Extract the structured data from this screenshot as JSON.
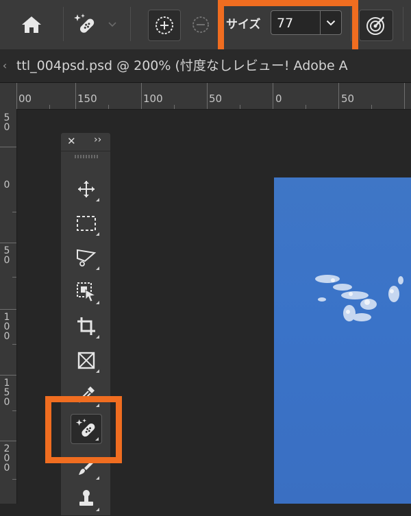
{
  "options_bar": {
    "home_icon": "home-icon",
    "tool_icon": "spot-healing-brush-icon",
    "add_icon": "circle-plus-icon",
    "subtract_icon": "circle-minus-icon",
    "size_label": "サイズ",
    "size_value": "77",
    "target_icon": "target-brush-icon"
  },
  "tab": {
    "title": "ttl_004psd.psd @ 200% (忖度なしレビュー! Adobe A",
    "scroll_left": "‹"
  },
  "ruler_h": {
    "labels": [
      "00",
      "150",
      "100",
      "50",
      "0",
      "50"
    ]
  },
  "ruler_v": {
    "labels": [
      "5\n0",
      "0",
      "5\n0",
      "1\n0\n0",
      "1\n5\n0",
      "2\n0\n0"
    ]
  },
  "tools_panel": {
    "close": "✕",
    "expand": "››",
    "tools": [
      {
        "name": "move-tool",
        "icon": "move-icon"
      },
      {
        "name": "marquee-tool",
        "icon": "rect-marquee-icon"
      },
      {
        "name": "lasso-tool",
        "icon": "polygonal-lasso-icon"
      },
      {
        "name": "object-selection-tool",
        "icon": "object-selection-icon"
      },
      {
        "name": "crop-tool",
        "icon": "crop-icon"
      },
      {
        "name": "frame-tool",
        "icon": "frame-icon"
      },
      {
        "name": "eyedropper-tool",
        "icon": "eyedropper-icon"
      },
      {
        "name": "spot-healing-tool",
        "icon": "spot-healing-brush-icon",
        "active": true
      },
      {
        "name": "brush-tool",
        "icon": "brush-icon"
      },
      {
        "name": "clone-stamp-tool",
        "icon": "stamp-icon"
      }
    ]
  },
  "colors": {
    "highlight": "#f06d20",
    "sky": "#3a73c8"
  }
}
